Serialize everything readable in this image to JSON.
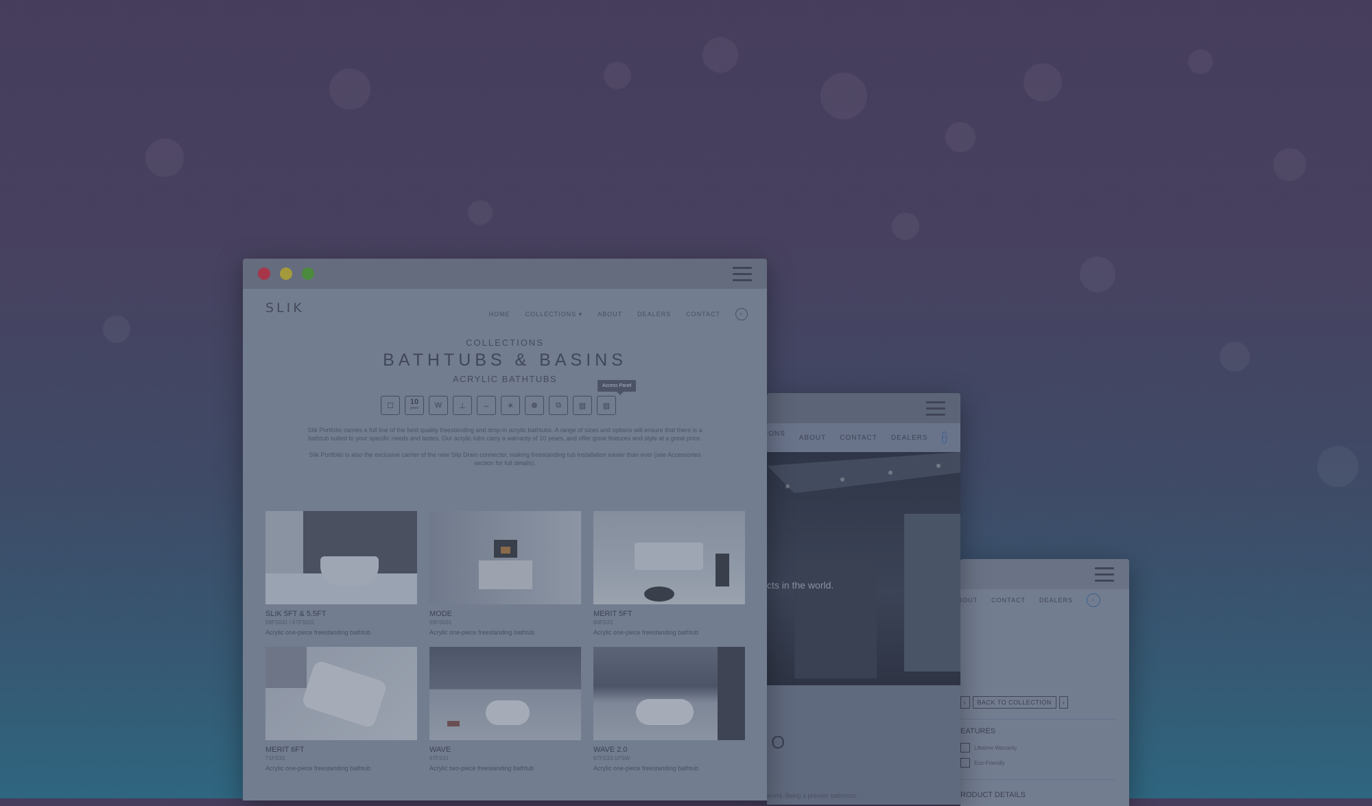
{
  "main": {
    "logo": "SLIK",
    "nav": [
      "HOME",
      "COLLECTIONS ▾",
      "ABOUT",
      "DEALERS",
      "CONTACT"
    ],
    "eyebrow": "COLLECTIONS",
    "title": "BATHTUBS & BASINS",
    "subtitle": "ACRYLIC BATHTUBS",
    "tooltip": "Access Panel",
    "feature_icons": [
      "tub-icon",
      "10-year-warranty-icon",
      "w-icon",
      "drain-icon",
      "overflow-icon",
      "light-icon",
      "jet-icon",
      "layers-icon",
      "install-icon",
      "access-panel-icon"
    ],
    "feature_10_top": "10",
    "feature_10_bottom": "years",
    "feature_w": "W",
    "desc1": "Slik Portfolio carries a full line of the best quality freestanding and drop-in acrylic bathtubs. A range of sizes and options will ensure that there is a bathtub suited to your specific needs and tastes. Our acrylic tubs carry a warranty of 10 years, and offer great features and style at a great price.",
    "desc2": "Slik Portfolio is also the exclusive carrier of the new Slip Drain connector, making freestanding tub installation easier than ever (see Accessories section for full details).",
    "products": [
      {
        "name": "SLIK 5FT & 5.5FT",
        "code": "59FS031 / 67FS031",
        "blurb": "Acrylic one-piece freestanding bathtub"
      },
      {
        "name": "MODE",
        "code": "59FS031",
        "blurb": "Acrylic one-piece freestanding bathtub"
      },
      {
        "name": "MERIT 5FT",
        "code": "60FS33",
        "blurb": "Acrylic one-piece freestanding bathtub"
      },
      {
        "name": "MERIT 6FT",
        "code": "71FS33",
        "blurb": "Acrylic one-piece freestanding bathtub"
      },
      {
        "name": "WAVE",
        "code": "67FS31",
        "blurb": "Acrylic two-piece freestanding bathtub"
      },
      {
        "name": "WAVE 2.0",
        "code": "67FS33-1PSW",
        "blurb": "Acrylic one-piece freestanding bathtub"
      }
    ]
  },
  "second": {
    "nav": [
      "CTIONS ▾",
      "ABOUT",
      "CONTACT",
      "DEALERS"
    ],
    "hero_text": "cts in the world.",
    "big_letter": "O",
    "small_text": "world. Being a premier bathroom"
  },
  "third": {
    "nav": [
      "ABOUT",
      "CONTACT",
      "DEALERS"
    ],
    "prev": "‹",
    "back": "BACK TO COLLECTION",
    "next": "›",
    "features_heading": "EATURES",
    "feature_items": [
      "Lifetime Warranty",
      "Eco-Friendly"
    ],
    "details_heading": "RODUCT DETAILS"
  },
  "colors": {
    "close": "#a8364a",
    "minimize": "#a49a3c",
    "zoom": "#4c8a3e"
  }
}
